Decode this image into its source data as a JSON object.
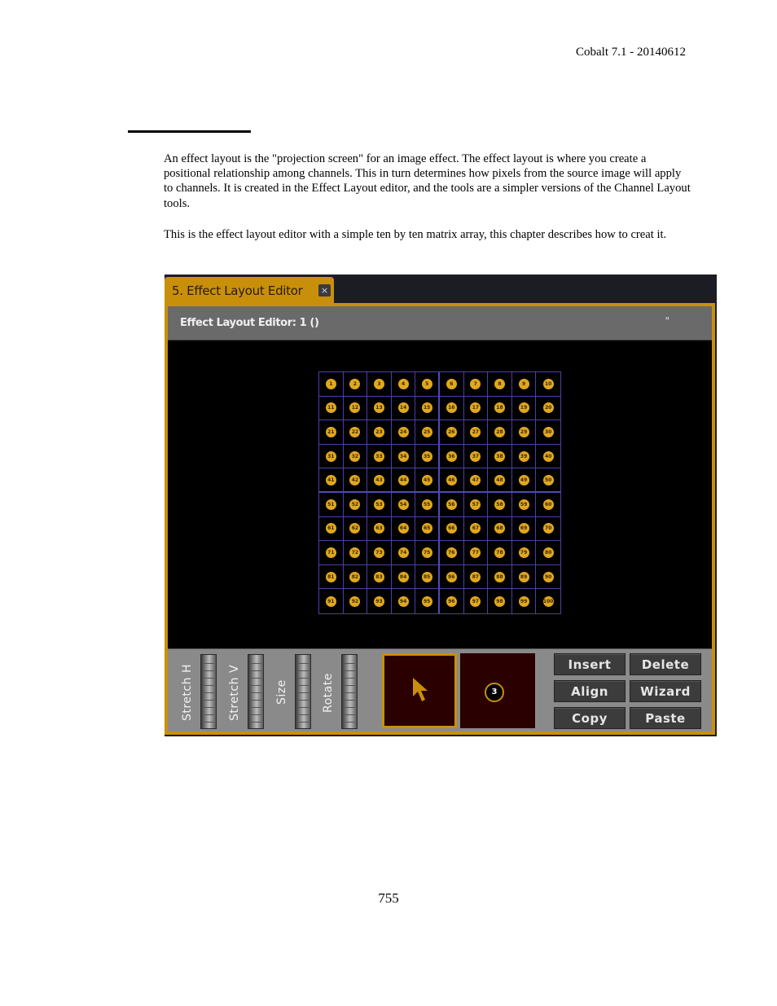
{
  "header": {
    "doc_title": "Cobalt 7.1 - 20140612"
  },
  "body": {
    "paragraph1": "An effect layout is the \"projection screen\" for an image effect. The effect layout is where you create a positional relationship among channels. This in turn determines how pixels from the source image will apply to channels. It is created in the Effect Layout editor, and the tools are a simpler versions of the Channel Layout tools.",
    "paragraph2": "This is the effect layout editor with a simple ten by ten matrix array, this chapter describes how to creat it."
  },
  "app": {
    "tab_label": "5. Effect Layout Editor",
    "tab_close": "×",
    "titlebar_label": "Effect Layout Editor: 1 ()",
    "grip": "\"",
    "grid": {
      "rows": 10,
      "cols": 10,
      "channel_start": 1,
      "channel_end": 100
    },
    "sliders": [
      {
        "label": "Stretch H"
      },
      {
        "label": "Stretch V"
      },
      {
        "label": "Size"
      },
      {
        "label": "Rotate"
      }
    ],
    "tools": {
      "select_tool": "cursor-icon",
      "channel_tool_number": "3"
    },
    "buttons": {
      "insert": "Insert",
      "delete": "Delete",
      "align": "Align",
      "wizard": "Wizard",
      "copy": "Copy",
      "paste": "Paste"
    },
    "colors": {
      "accent": "#c8900a",
      "grid_line": "#4a40a8",
      "dot": "#e0a820",
      "tool_bg": "#2a0000"
    }
  },
  "footer": {
    "page_number": "755"
  }
}
